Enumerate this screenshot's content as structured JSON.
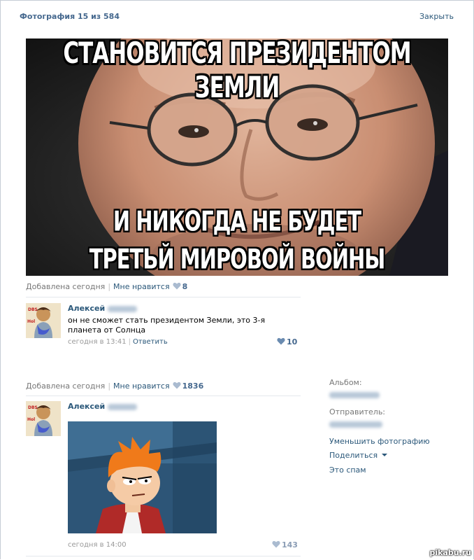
{
  "header": {
    "title": "Фотография 15 из 584",
    "close_label": "Закрыть"
  },
  "photo": {
    "caption_top": "СТАНОВИТСЯ ПРЕЗИДЕНТОМ ЗЕМЛИ",
    "caption_bottom_1": "И НИКОГДА НЕ БУДЕТ",
    "caption_bottom_2": "ТРЕТЬЙ МИРОВОЙ ВОЙНЫ",
    "added_label": "Добавлена сегодня",
    "dislike_label": "Мне нравится",
    "like_count": "8"
  },
  "comment1": {
    "author": "Алексей",
    "avatar_text_top": "DBS",
    "avatar_text_side": "Hol",
    "text": "он не сможет стать президентом Земли, это 3-я планета от Солнца",
    "time": "сегодня в 13:41",
    "reply_label": "Ответить",
    "like_count": "10"
  },
  "photo2": {
    "added_label": "Добавлена сегодня",
    "dislike_label": "Мне нравится",
    "like_count": "1836"
  },
  "comment2": {
    "author": "Алексей",
    "time": "сегодня в 14:00",
    "like_count": "143"
  },
  "sidebar": {
    "album_label": "Альбом:",
    "sender_label": "Отправитель:",
    "reduce_photo": "Уменьшить фотографию",
    "share": "Поделиться",
    "spam": "Это спам"
  },
  "watermark": "pikabu.ru",
  "colors": {
    "link": "#2b587a",
    "title": "#45688e",
    "muted": "#777777",
    "heart": "#aabbd0"
  },
  "icons": [
    "heart-icon",
    "caret-down-icon"
  ]
}
